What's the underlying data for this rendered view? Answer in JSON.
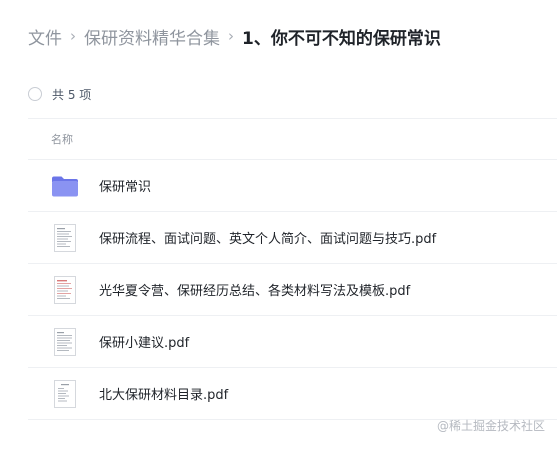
{
  "breadcrumb": {
    "root": "文件",
    "parent": "保研资料精华合集",
    "current": "1、你不可不知的保研常识",
    "separator": "›"
  },
  "summary": {
    "count_text": "共 5 项"
  },
  "table": {
    "header_name": "名称",
    "rows": [
      {
        "name": "保研常识",
        "icon": "folder-icon"
      },
      {
        "name": "保研流程、面试问题、英文个人简介、面试问题与技巧.pdf",
        "icon": "pdf-thumbnail-icon"
      },
      {
        "name": "光华夏令营、保研经历总结、各类材料写法及模板.pdf",
        "icon": "pdf-thumbnail-icon"
      },
      {
        "name": "保研小建议.pdf",
        "icon": "pdf-thumbnail-icon"
      },
      {
        "name": "北大保研材料目录.pdf",
        "icon": "pdf-thumbnail-icon"
      }
    ]
  },
  "watermark": "@稀土掘金技术社区",
  "colors": {
    "folder": "#7c86f0",
    "text_primary": "#1f2329",
    "text_secondary": "#8f959e",
    "divider": "#eef0f3"
  }
}
